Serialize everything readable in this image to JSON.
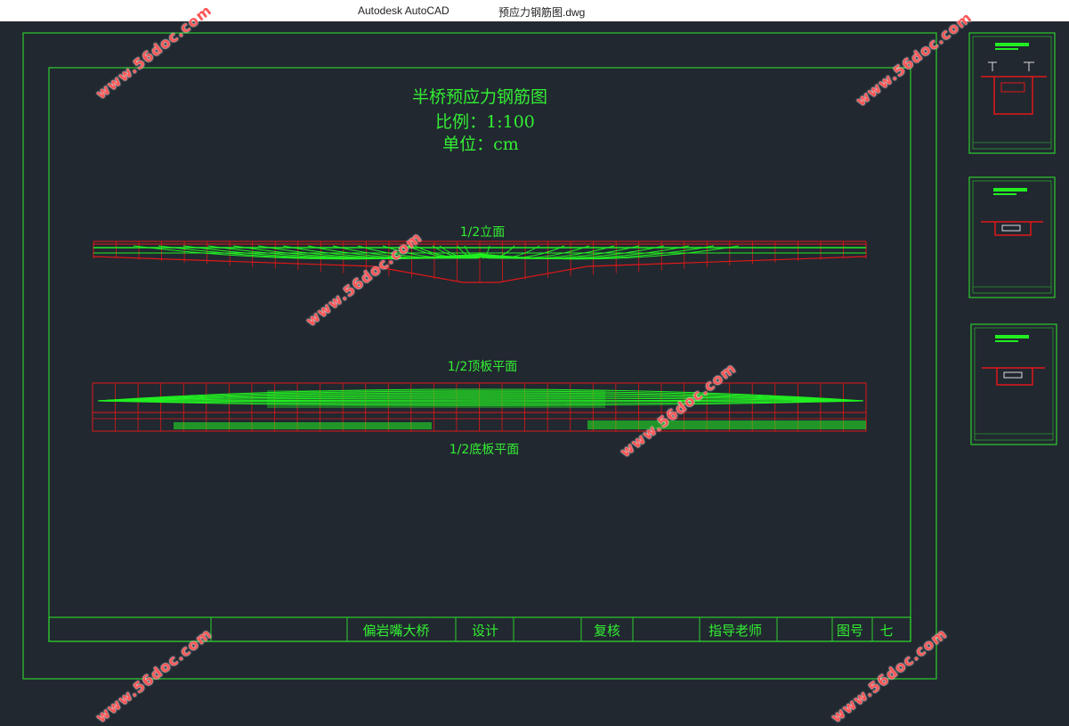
{
  "window": {
    "app_title": "Autodesk AutoCAD",
    "file_title": "预应力钢筋图.dwg"
  },
  "drawing": {
    "title": "半桥预应力钢筋图",
    "scale": "比例：1:100",
    "unit": "单位：cm",
    "view_elevation": "1/2立面",
    "view_top_plan": "1/2顶板平面",
    "view_bottom_plan": "1/2底板平面"
  },
  "title_block": {
    "project": "偏岩嘴大桥",
    "design": "设计",
    "review": "复核",
    "advisor": "指导老师",
    "drawing_no_label": "图号",
    "drawing_no": "七"
  },
  "watermark": "www.56doc.com",
  "colors": {
    "background": "#212830",
    "frame": "#2ecc2e",
    "text": "#33ee33",
    "red": "#e01818",
    "watermark": "#ff5555"
  },
  "thumbnails": [
    {
      "name": "section-thumb-1"
    },
    {
      "name": "section-thumb-2"
    },
    {
      "name": "section-thumb-3"
    }
  ]
}
